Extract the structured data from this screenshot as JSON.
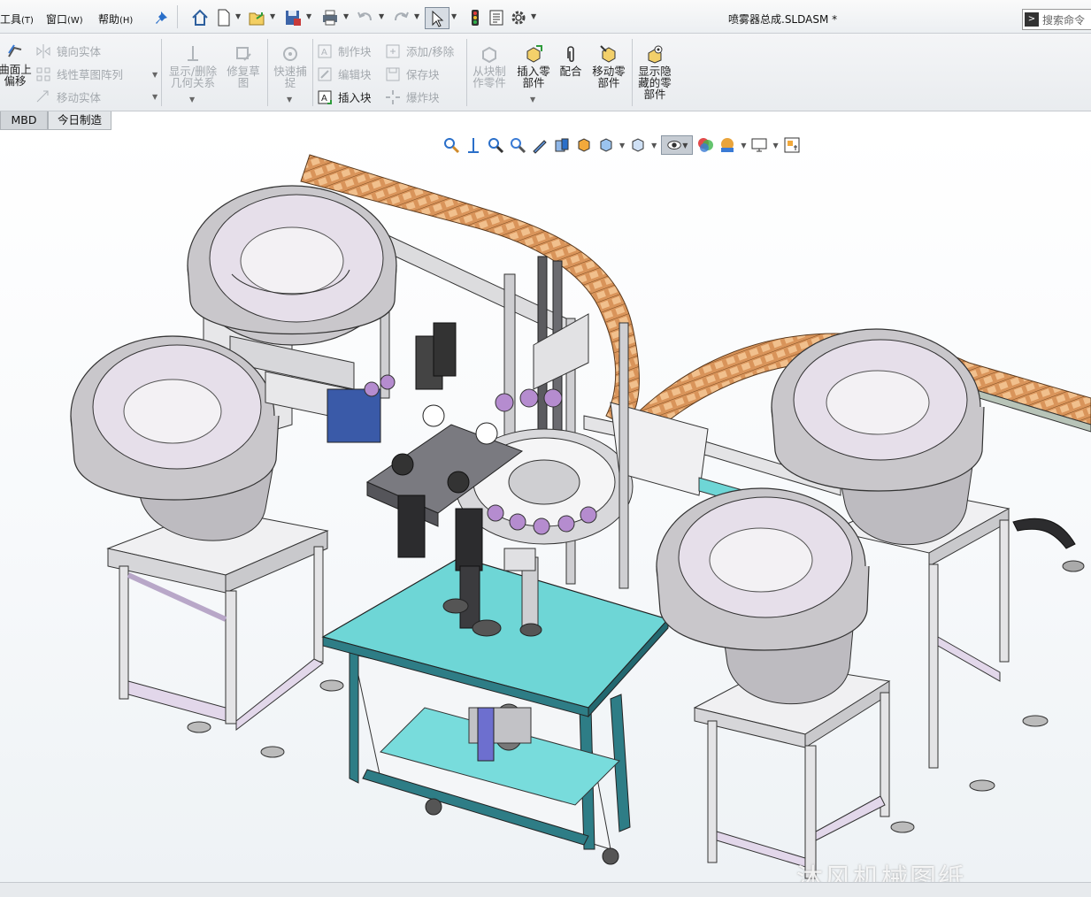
{
  "menubar": {
    "items": [
      {
        "label": "工具",
        "key": "(T)"
      },
      {
        "label": "窗口",
        "key": "(W)"
      },
      {
        "label": "帮助",
        "key": "(H)"
      }
    ],
    "doc_title": "喷雾器总成.SLDASM *",
    "search_placeholder": "搜索命令",
    "quick_access_icons": [
      "pin-icon",
      "home-icon",
      "new-document-icon",
      "open-icon",
      "save-icon",
      "print-icon",
      "undo-icon",
      "redo-icon",
      "select-arrow-icon",
      "traffic-light-icon",
      "file-properties-icon",
      "options-gear-icon"
    ]
  },
  "ribbon": {
    "offset_surface": {
      "line1": "曲面上",
      "line2": "偏移"
    },
    "mirror_entity": "镜向实体",
    "linear_sketch_pattern": "线性草图阵列",
    "move_entity": "移动实体",
    "show_delete_relations": {
      "line1": "显示/删除",
      "line2": "几何关系"
    },
    "repair_sketch": {
      "line1": "修复草",
      "line2": "图"
    },
    "quick_snap": {
      "line1": "快速捕",
      "line2": "捉"
    },
    "make_block": "制作块",
    "edit_block": "编辑块",
    "insert_block": "插入块",
    "add_remove": "添加/移除",
    "save_block": "保存块",
    "explode_block": "爆炸块",
    "make_part_from_block": {
      "line1": "从块制",
      "line2": "作零件"
    },
    "insert_component": {
      "line1": "插入零",
      "line2": "部件"
    },
    "mate": "配合",
    "move_component": {
      "line1": "移动零",
      "line2": "部件"
    },
    "show_hidden_components": {
      "line1": "显示隐",
      "line2": "藏的零",
      "line3": "部件"
    }
  },
  "tabs": [
    {
      "label": "MBD",
      "active": true
    },
    {
      "label": "今日制造",
      "active": false
    }
  ],
  "headsup_icons": [
    "zoom-to-fit-icon",
    "zoom-to-area-icon",
    "previous-view-icon",
    "section-view-icon",
    "dynamic-annotation-icon",
    "view-orientation-icon",
    "display-style-icon",
    "hide-show-items-icon",
    "edit-appearance-icon",
    "apply-scene-icon",
    "view-settings-icon",
    "monitor-icon",
    "screen-capture-icon"
  ],
  "watermark": "沐风机械图纸",
  "colors": {
    "frame": "#d8d8da",
    "frame_edge": "#3a3a3a",
    "bowl": "#c9c7cb",
    "bowl_inner": "#e6dfea",
    "table_top": "#6ed6d6",
    "conveyor": "#d9945a"
  }
}
